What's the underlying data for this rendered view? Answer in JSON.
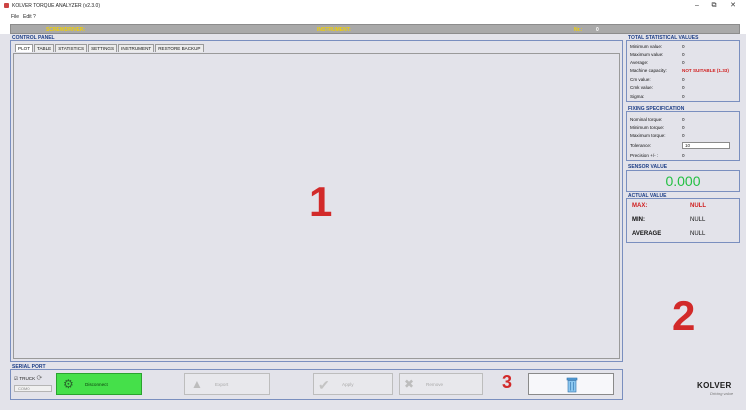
{
  "window": {
    "title": "KOLVER TORQUE ANALYZER (v2.3.0)",
    "minimize": "–",
    "maximize": "⧉",
    "close": "✕"
  },
  "menu": {
    "file": "File",
    "edit": "Edit",
    "help": "?"
  },
  "info_bar": {
    "screwdriver_label": "SCREWDRIVER:",
    "instrument_label": "INSTRUMENT:",
    "count_label": "Nr.:",
    "count_value": "0"
  },
  "control_panel": {
    "title": "CONTROL PANEL",
    "tabs": [
      "PLOT",
      "TABLE",
      "STATISTICS",
      "SETTINGS",
      "INSTRUMENT",
      "RESTORE BACKUP"
    ]
  },
  "annotations": {
    "one": "1",
    "two": "2",
    "three": "3"
  },
  "total_stats": {
    "title": "TOTAL STATISTICAL VALUES",
    "rows": [
      {
        "label": "Minimum value:",
        "value": "0"
      },
      {
        "label": "Maximum value:",
        "value": "0"
      },
      {
        "label": "Average:",
        "value": "0"
      },
      {
        "label": "Machine capacity:",
        "value": "NOT SUITABLE (1.33)"
      },
      {
        "label": "Cm value:",
        "value": "0"
      },
      {
        "label": "Cmk value:",
        "value": "0"
      },
      {
        "label": "Sigma:",
        "value": "0"
      }
    ]
  },
  "fixing_spec": {
    "title": "FIXING SPECIFICATION",
    "rows": [
      {
        "label": "Nominal torque:",
        "value": "0"
      },
      {
        "label": "Minimum torque:",
        "value": "0"
      },
      {
        "label": "Maximum torque:",
        "value": "0"
      }
    ],
    "tolerance_label": "Tolerance:",
    "tolerance_value": "10",
    "precision_label": "Precision +/- :",
    "precision_value": "0"
  },
  "sensor": {
    "title": "SENSOR VALUE",
    "value": "0.000"
  },
  "actual": {
    "title": "ACTUAL VALUE",
    "rows": [
      {
        "label": "MAX:",
        "value": "NULL"
      },
      {
        "label": "MIN:",
        "value": "NULL"
      },
      {
        "label": "AVERAGE",
        "value": "NULL"
      }
    ]
  },
  "serial": {
    "title": "SERIAL PORT",
    "truck_label": "TRUCK",
    "com_placeholder": "COM0",
    "connect_label": "Disconnect",
    "export_label": "Export",
    "apply_label": "Apply",
    "remove_label": "Remove"
  },
  "brand": {
    "logo": "KOLVER",
    "tagline": "Driving value"
  },
  "colors": {
    "accent_blue": "#1d3e86",
    "alert_red": "#d01d1d",
    "sensor_green": "#23c043",
    "connect_green": "#45e04a"
  }
}
